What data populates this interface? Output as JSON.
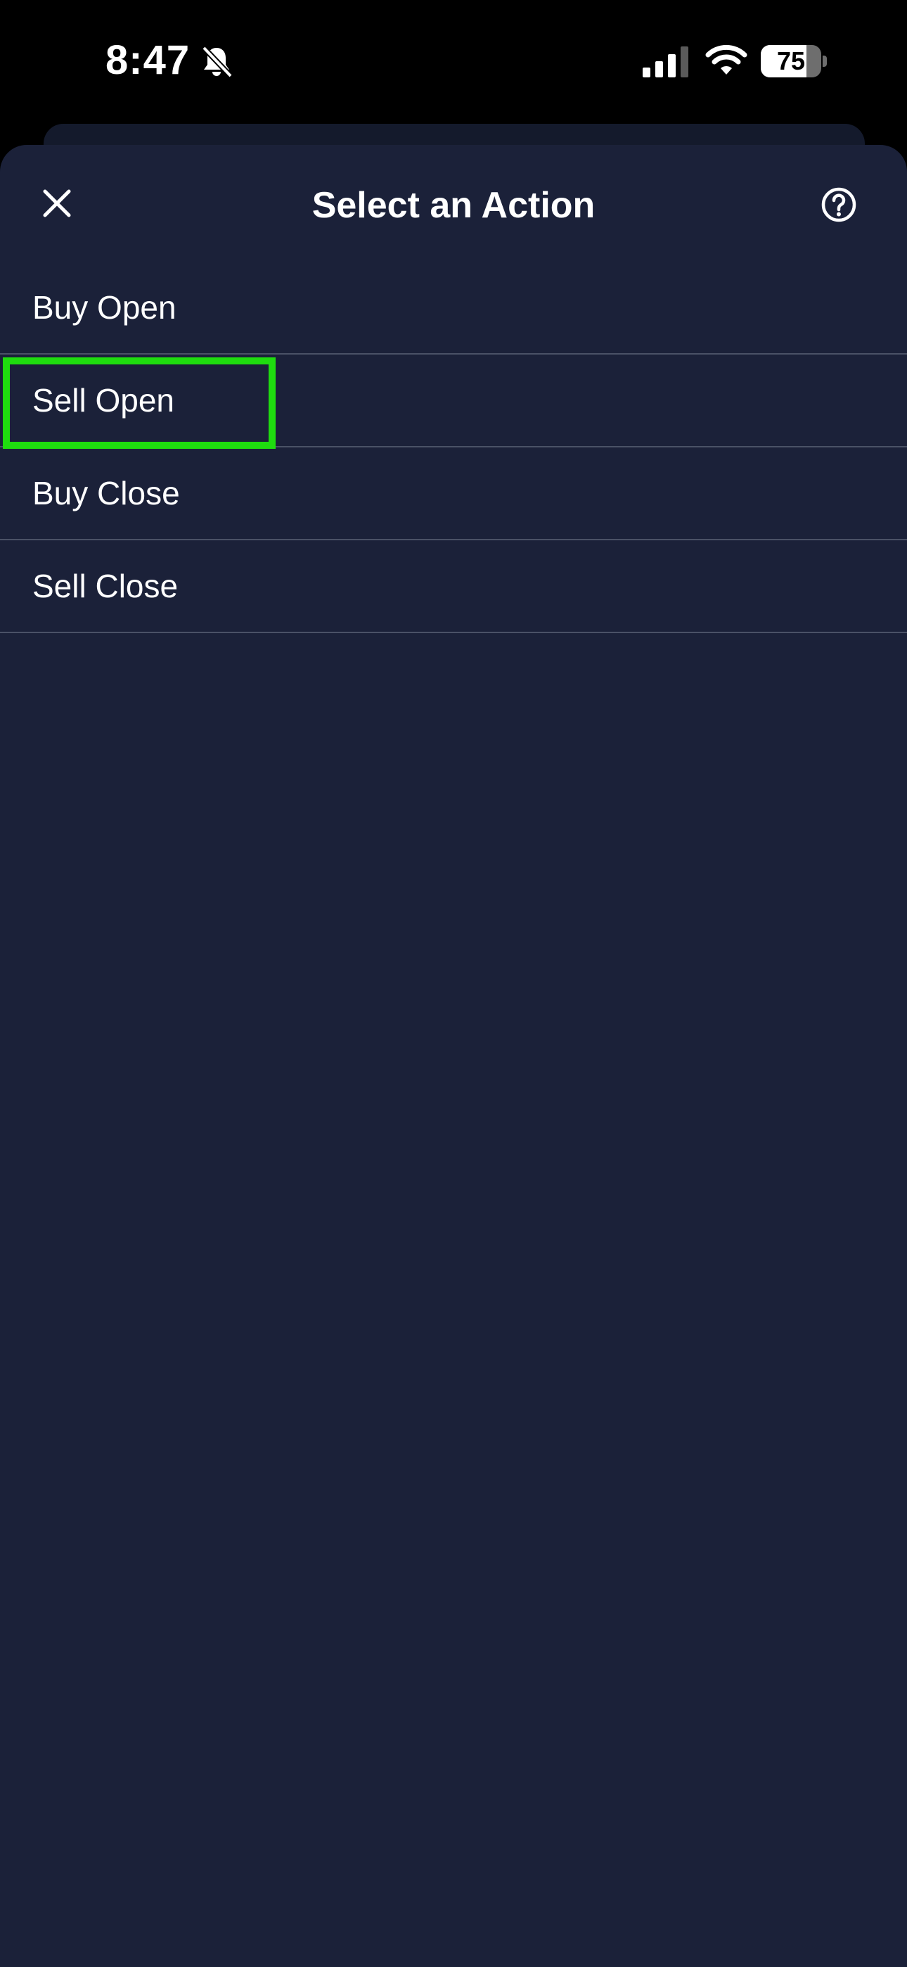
{
  "status_bar": {
    "time": "8:47",
    "battery_level": 75,
    "battery_text": "75",
    "icons": [
      "bell-slash-icon",
      "cellular-signal-icon",
      "wifi-icon",
      "battery-icon"
    ]
  },
  "sheet": {
    "title": "Select an Action",
    "close_icon": "close-icon",
    "help_icon": "help-icon"
  },
  "actions": [
    {
      "label": "Buy Open"
    },
    {
      "label": "Sell Open",
      "highlighted": true
    },
    {
      "label": "Buy Close"
    },
    {
      "label": "Sell Close"
    }
  ],
  "colors": {
    "sheet_background": "#1b2139",
    "divider": "#4a5166",
    "highlight": "#1fdc0f",
    "text": "#ffffff"
  }
}
